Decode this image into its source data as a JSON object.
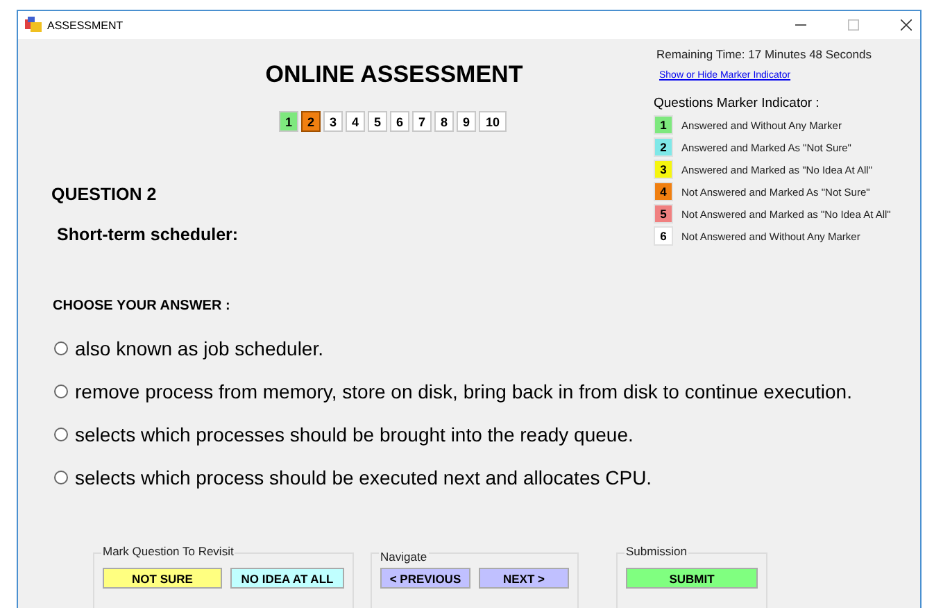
{
  "window": {
    "title": "ASSESSMENT"
  },
  "heading": "ONLINE ASSESSMENT",
  "questions": [
    {
      "label": "1",
      "color": "#7ee87e",
      "selected": false
    },
    {
      "label": "2",
      "color": "#f07f10",
      "selected": true
    },
    {
      "label": "3",
      "color": "#ffffff",
      "selected": false
    },
    {
      "label": "4",
      "color": "#ffffff",
      "selected": false
    },
    {
      "label": "5",
      "color": "#ffffff",
      "selected": false
    },
    {
      "label": "6",
      "color": "#ffffff",
      "selected": false
    },
    {
      "label": "7",
      "color": "#ffffff",
      "selected": false
    },
    {
      "label": "8",
      "color": "#ffffff",
      "selected": false
    },
    {
      "label": "9",
      "color": "#ffffff",
      "selected": false
    },
    {
      "label": "10",
      "color": "#ffffff",
      "selected": false
    }
  ],
  "remaining_time": "Remaining Time: 17 Minutes 48 Seconds",
  "marker_toggle_link": "Show or Hide Marker Indicator",
  "marker_indicator": {
    "title": "Questions Marker Indicator :",
    "items": [
      {
        "number": "1",
        "color": "#7ee87e",
        "label": "Answered and Without Any Marker"
      },
      {
        "number": "2",
        "color": "#7fe8e8",
        "label": "Answered and Marked As \"Not Sure\""
      },
      {
        "number": "3",
        "color": "#f5f50f",
        "label": "Answered and Marked as \"No Idea At All\""
      },
      {
        "number": "4",
        "color": "#f07f10",
        "label": "Not Answered and Marked As \"Not Sure\""
      },
      {
        "number": "5",
        "color": "#f08080",
        "label": "Not Answered and Marked as \"No Idea At All\""
      },
      {
        "number": "6",
        "color": "#ffffff",
        "label": "Not Answered and Without Any Marker"
      }
    ]
  },
  "question": {
    "number_label": "QUESTION  2",
    "text": "Short-term scheduler:"
  },
  "answer_prompt": "CHOOSE YOUR ANSWER :",
  "options": [
    {
      "label": "also known as job scheduler.",
      "selected": false
    },
    {
      "label": "remove process from memory, store on disk, bring back in from disk to continue execution.",
      "selected": false
    },
    {
      "label": "selects which processes should be brought into the ready queue.",
      "selected": false
    },
    {
      "label": "selects which process should be executed next and allocates CPU.",
      "selected": false
    }
  ],
  "groups": [
    {
      "title": "Mark Question To Revisit",
      "buttons": [
        {
          "label": "NOT SURE",
          "color": "#ffff80"
        },
        {
          "label": "NO IDEA AT ALL",
          "color": "#c0ffff"
        }
      ]
    },
    {
      "title": "Navigate",
      "buttons": [
        {
          "label": "< PREVIOUS",
          "color": "#c0c0ff"
        },
        {
          "label": "NEXT >",
          "color": "#c0c0ff"
        }
      ]
    },
    {
      "title": "Submission",
      "buttons": [
        {
          "label": "SUBMIT",
          "color": "#80ff80"
        }
      ]
    }
  ]
}
